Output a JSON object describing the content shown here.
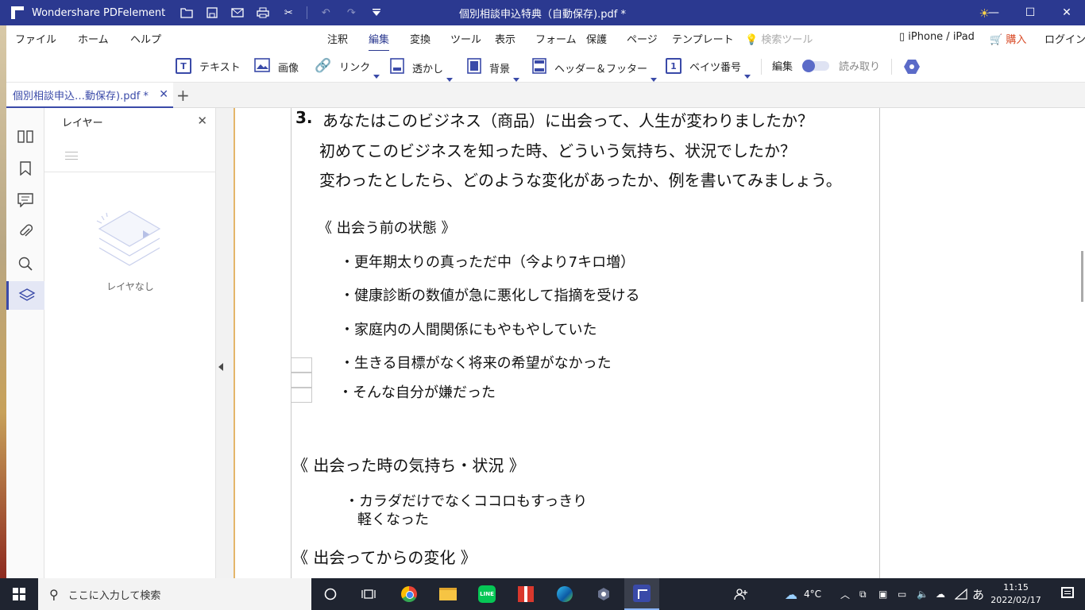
{
  "window": {
    "app_name": "Wondershare PDFelement",
    "doc_title": "個別相談申込特典（自動保存).pdf *"
  },
  "menu": {
    "file": "ファイル",
    "home": "ホーム",
    "help": "ヘルプ",
    "annotate": "注釈",
    "edit": "編集",
    "convert": "変換",
    "tools": "ツール",
    "view": "表示",
    "form": "フォーム",
    "protect": "保護",
    "page": "ページ",
    "template": "テンプレート",
    "search_tools": "検索ツール",
    "iphone": "iPhone / iPad",
    "buy": "購入",
    "login": "ログイン"
  },
  "toolbar": {
    "text": "テキスト",
    "image": "画像",
    "link": "リンク",
    "watermark": "透かし",
    "background": "背景",
    "header_footer": "ヘッダー＆フッター",
    "bates": "ベイツ番号",
    "edit_mode": "編集",
    "read_mode": "読み取り",
    "text_icon_glyph": "T",
    "bates_icon_glyph": "1"
  },
  "tab": {
    "label": "個別相談申込…動保存).pdf *"
  },
  "panel": {
    "title": "レイヤー",
    "empty": "レイヤなし"
  },
  "document": {
    "q_number": "3.",
    "q_line1": "あなたはこのビジネス（商品）に出会って、人生が変わりましたか？",
    "q_line2": "初めてこのビジネスを知った時、どういう気持ち、状況でしたか？",
    "q_line3": "変わったとしたら、どのような変化があったか、例を書いてみましょう。",
    "sec1": "《 出会う前の状態 》",
    "b1": "・更年期太りの真っただ中（今より7キロ増）",
    "b2": "・健康診断の数値が急に悪化して指摘を受ける",
    "b3": "・家庭内の人間関係にもやもやしていた",
    "b4": "・生きる目標がなく将来の希望がなかった",
    "b5": "・そんな自分が嫌だった",
    "sec2": "《 出会った時の気持ち・状況 》",
    "b6a": "・カラダだけでなくココロもすっきり",
    "b6b": "軽くなった",
    "sec3": "《 出会ってからの変化 》"
  },
  "taskbar": {
    "search_placeholder": "ここに入力して検索",
    "weather": "4°C",
    "ime": "あ",
    "time": "11:15",
    "date": "2022/02/17",
    "line_label": "LINE"
  },
  "colors": {
    "brand": "#2b3990",
    "accent": "#3a4aa8",
    "buy": "#d94e2b"
  }
}
